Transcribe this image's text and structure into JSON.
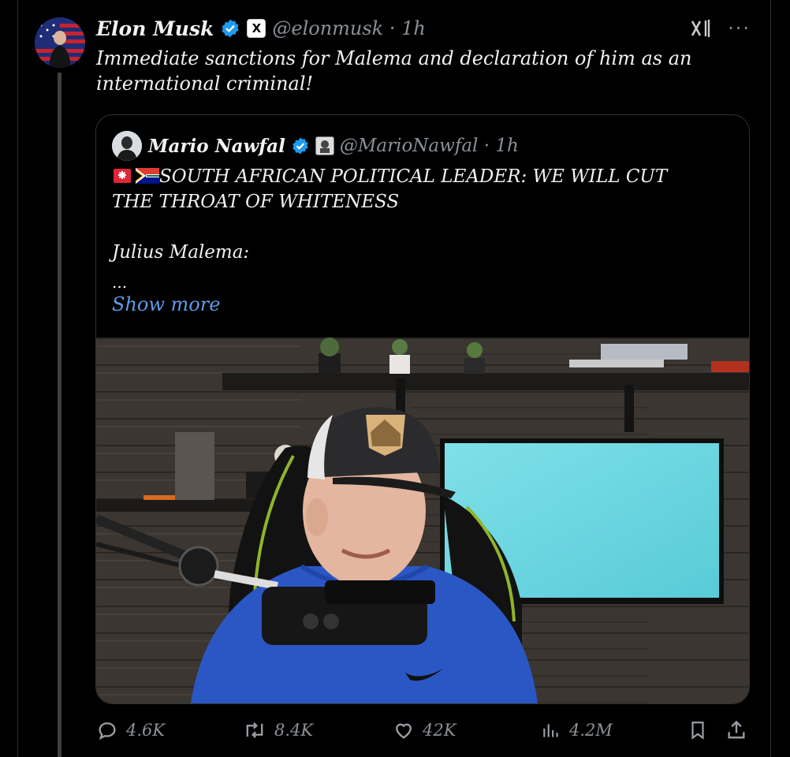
{
  "tweet": {
    "author_name": "Elon Musk",
    "x_badge": "X",
    "handle_time": "@elonmusk · 1h",
    "more_label": "···",
    "text": "Immediate sanctions for Malema and declaration of him as an international criminal!"
  },
  "quote": {
    "author_name": "Mario Nawfal",
    "handle_time": "@MarioNawfal · 1h",
    "headline_line1": "SOUTH AFRICAN POLITICAL LEADER: WE WILL CUT",
    "headline_line2": "THE THROAT OF WHITENESS",
    "speaker": "Julius Malema:",
    "ellipsis": "...",
    "show_more": "Show more"
  },
  "actions": {
    "replies": "4.6K",
    "reposts": "8.4K",
    "likes": "42K",
    "views": "4.2M"
  },
  "icons": {
    "verified": "verified-badge-icon",
    "grok": "grok-icon",
    "reply": "reply-icon",
    "repost": "repost-icon",
    "like": "heart-icon",
    "views": "views-chart-icon",
    "bookmark": "bookmark-icon",
    "share": "share-icon"
  },
  "colors": {
    "background": "#000000",
    "verified_blue": "#1d9bf0",
    "link_blue": "#5e9be6",
    "muted": "#8b9196"
  }
}
